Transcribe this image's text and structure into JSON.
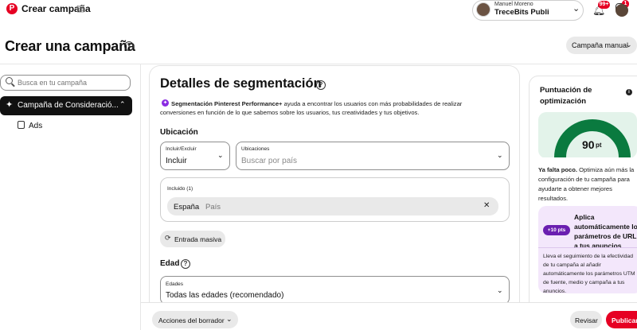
{
  "header": {
    "logo_glyph": "P",
    "app_title": "Crear campaña",
    "account": {
      "name": "Manuel Moreno",
      "business": "TreceBits Publi"
    },
    "notifications_badge": "99+",
    "messages_badge": "1"
  },
  "page": {
    "title": "Crear una campaña",
    "campaign_mode": "Campaña manual"
  },
  "sidebar": {
    "search_placeholder": "Busca en tu campaña",
    "campaign_label": "Campaña de Consideració...",
    "ads_label": "Ads"
  },
  "main": {
    "section_title": "Detalles de segmentación",
    "description_bold": "Segmentación Pinterest Performance+",
    "description_line1": " ayuda a encontrar los usuarios con más probabilidades de realizar",
    "description_line2": "conversiones en función de lo que sabemos sobre los usuarios, tus creatividades y tus objetivos.",
    "location": {
      "heading": "Ubicación",
      "include_label": "Incluir/Excluir",
      "include_value": "Incluir",
      "locations_label": "Ubicaciones",
      "locations_placeholder": "Buscar por país",
      "included_label": "Incluido (1)",
      "chip_name": "España",
      "chip_type": "País",
      "bulk_button": "Entrada masiva"
    },
    "age": {
      "heading": "Edad",
      "field_label": "Edades",
      "field_value": "Todas las edades (recomendado)"
    }
  },
  "score_panel": {
    "title": "Puntuación de optimización",
    "score": "90",
    "unit": "pt",
    "score_fraction": 0.9,
    "message_bold": "Ya falta poco.",
    "message": " Optimiza aún más la configuración de tu campaña para ayudarte a obtener mejores resultados.",
    "recommendation": {
      "badge": "+10 pts",
      "title": "Aplica automáticamente los parámetros de URL a tus anuncios",
      "description": "Lleva el seguimiento de la efectividad de tu campaña al añadir automáticamente los parámetros UTM de fuente, medio y campaña a tus anuncios."
    }
  },
  "footer": {
    "draft_actions": "Acciones del borrador",
    "review": "Revisar",
    "publish": "Publicar"
  },
  "colors": {
    "brand": "#e60023",
    "gauge": "#0a7a3f",
    "recommendation_bg": "#f3e7fb"
  }
}
